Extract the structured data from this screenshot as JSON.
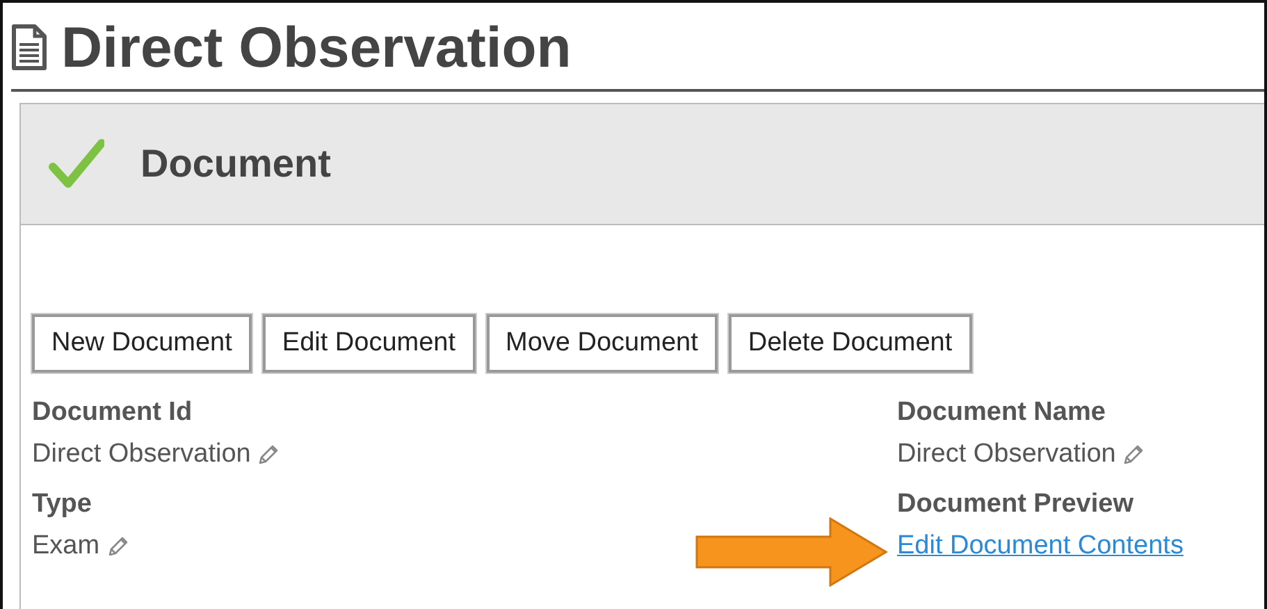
{
  "page_title": "Direct Observation",
  "panel": {
    "heading": "Document",
    "complete": true
  },
  "buttons": [
    "New Document",
    "Edit Document",
    "Move Document",
    "Delete Document"
  ],
  "fields": [
    {
      "label": "Document Id",
      "value": "Direct Observation",
      "kind": "text",
      "editable": true
    },
    {
      "label": "Document Name",
      "value": "Direct Observation",
      "kind": "text",
      "editable": true
    },
    {
      "label": "Type",
      "value": "Exam",
      "kind": "text",
      "editable": true
    },
    {
      "label": "Document Preview",
      "value": "Edit Document Contents",
      "kind": "link",
      "editable": false,
      "highlighted": true
    }
  ]
}
